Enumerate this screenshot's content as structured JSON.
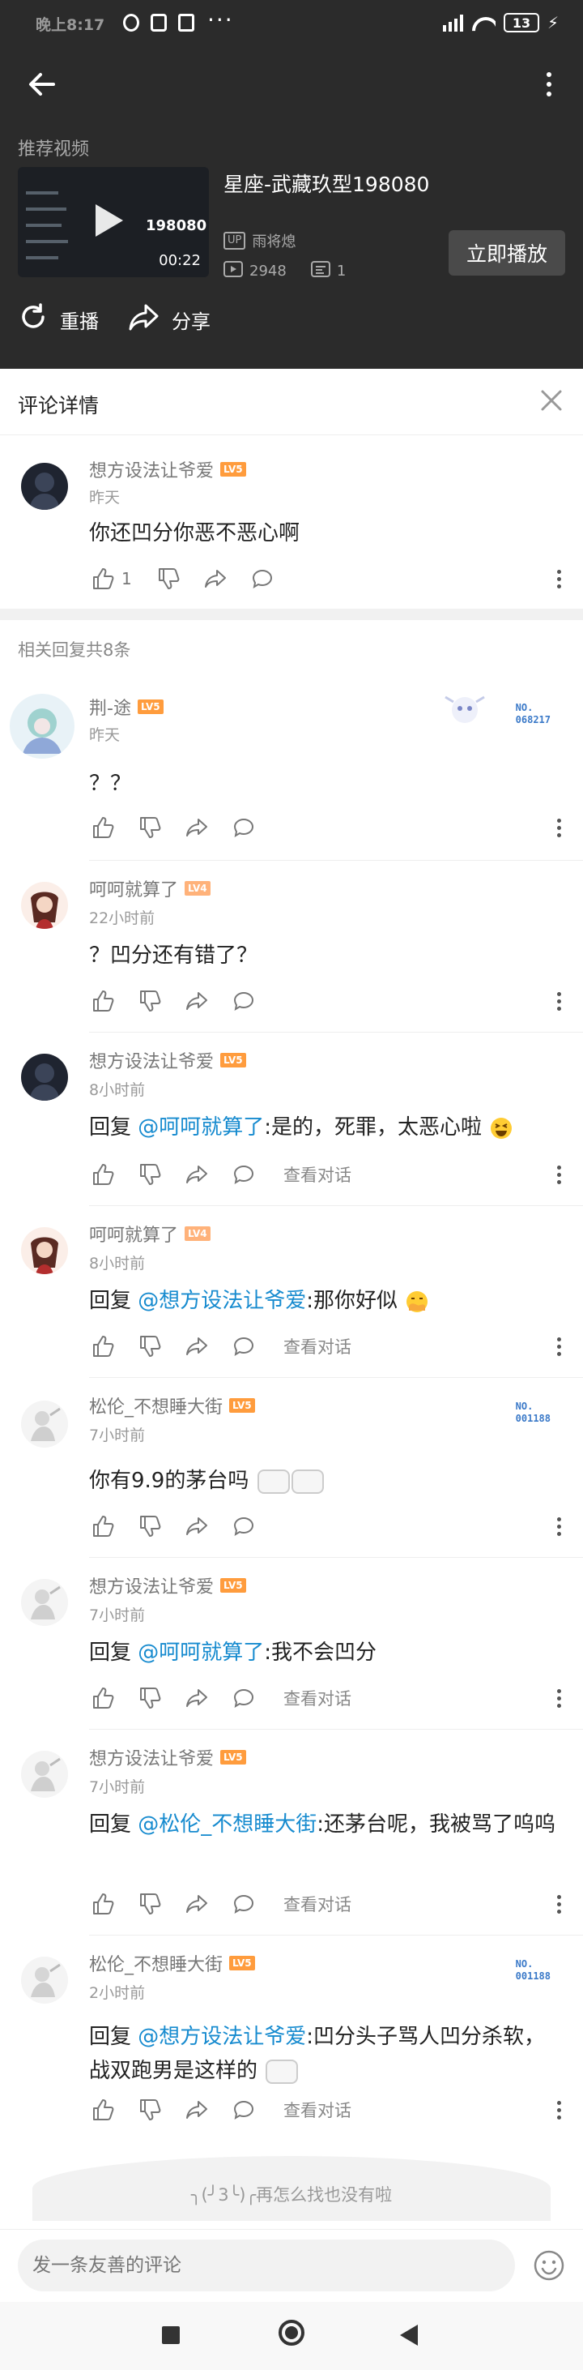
{
  "status_bar": {
    "time": "晚上8:17",
    "dots": "···",
    "battery": "13"
  },
  "player": {
    "section_label": "推荐视频",
    "video": {
      "title": "星座-武藏玖型198080",
      "thumb_number": "198080",
      "duration": "00:22",
      "uploader_tag": "UP",
      "uploader": "雨将熄",
      "plays": "2948",
      "danmaku": "1"
    },
    "play_now": "立即播放",
    "replay": "重播",
    "share": "分享"
  },
  "detail": {
    "title": "评论详情"
  },
  "root_comment": {
    "user": "想方设法让爷爱",
    "level": "LV5",
    "time": "昨天",
    "text": "你还凹分你恶不恶心啊",
    "likes": "1"
  },
  "related_label": "相关回复共8条",
  "replies": [
    {
      "user": "荆-途",
      "level": "LV5",
      "time": "昨天",
      "text": "？？",
      "badge": "NO.\n068217"
    },
    {
      "user": "呵呵就算了",
      "level": "LV4",
      "time": "22小时前",
      "text": "？凹分还有错了？"
    },
    {
      "user": "想方设法让爷爱",
      "level": "LV5",
      "time": "8小时前",
      "prefix": "回复 ",
      "mention": "@呵呵就算了",
      "text": ":是的，死罪，太恶心啦",
      "view": "查看对话"
    },
    {
      "user": "呵呵就算了",
      "level": "LV4",
      "time": "8小时前",
      "prefix": "回复 ",
      "mention": "@想方设法让爷爱",
      "text": ":那你好似",
      "view": "查看对话"
    },
    {
      "user": "松伦_不想睡大街",
      "level": "LV5",
      "time": "7小时前",
      "text": "你有9.9的茅台吗",
      "badge": "NO.\n001188"
    },
    {
      "user": "想方设法让爷爱",
      "level": "LV5",
      "time": "7小时前",
      "prefix": "回复 ",
      "mention": "@呵呵就算了",
      "text": ":我不会凹分",
      "view": "查看对话"
    },
    {
      "user": "想方设法让爷爱",
      "level": "LV5",
      "time": "7小时前",
      "prefix": "回复 ",
      "mention": "@松伦_不想睡大街",
      "text": ":还茅台呢，我被骂了呜呜",
      "view": "查看对话"
    },
    {
      "user": "松伦_不想睡大街",
      "level": "LV5",
      "time": "2小时前",
      "prefix": "回复 ",
      "mention": "@想方设法让爷爱",
      "text": ":凹分头子骂人凹分杀软，战双跑男是这样的",
      "view": "查看对话",
      "badge": "NO.\n001188"
    }
  ],
  "end_text": "╮(╯3╰)╭再怎么找也没有啦",
  "composer": {
    "placeholder": "发一条友善的评论"
  },
  "icons": {
    "back": "back-arrow-icon",
    "more": "more-vertical-icon",
    "replay": "replay-icon",
    "share": "share-icon",
    "close": "close-icon",
    "like": "thumbs-up-icon",
    "dislike": "thumbs-down-icon",
    "forward": "share-arrow-icon",
    "reply": "comment-bubble-icon",
    "emoji": "emoji-icon"
  },
  "colors": {
    "dark_bg": "#2b2b2b",
    "mention": "#178bcf",
    "level_badge": "#ff9c3d"
  }
}
